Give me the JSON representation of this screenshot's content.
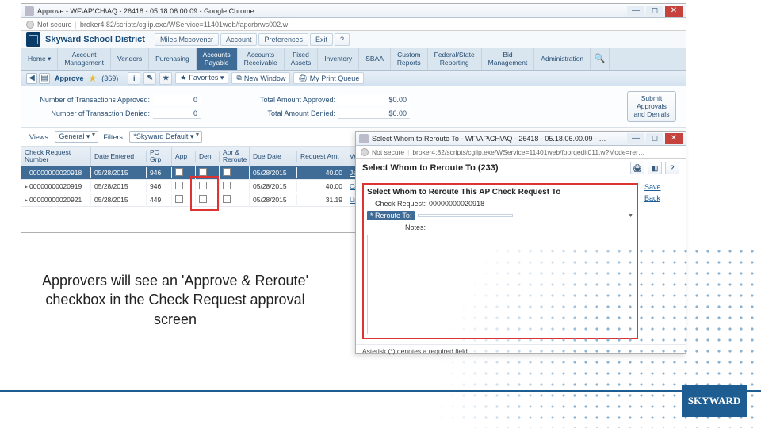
{
  "main": {
    "title": "Approve - WF\\AP\\CH\\AQ - 26418 - 05.18.06.00.09 - Google Chrome",
    "security_label": "Not secure",
    "url": "broker4:82/scripts/cgiip.exe/WService=11401web/fapcrbrws002.w",
    "brand": "Skyward School District",
    "top_links": [
      "Miles Mccovencr",
      "Account",
      "Preferences",
      "Exit",
      "?"
    ],
    "nav_tabs": [
      "Home ▾",
      "Account\nManagement",
      "Vendors",
      "Purchasing",
      "Accounts\nPayable",
      "Accounts\nReceivable",
      "Fixed\nAssets",
      "Inventory",
      "SBAA",
      "Custom\nReports",
      "Federal/State\nReporting",
      "Bid\nManagement",
      "Administration"
    ],
    "section": {
      "title": "Approve",
      "count": "(369)"
    },
    "toolbar": {
      "favorites": "Favorites ▾",
      "new_window": "New Window",
      "print_queue": "My Print Queue"
    },
    "stats": {
      "trans_approved_label": "Number of Transactions Approved:",
      "trans_approved": "0",
      "trans_denied_label": "Number of Transaction Denied:",
      "trans_denied": "0",
      "amt_approved_label": "Total Amount Approved:",
      "amt_approved": "$0.00",
      "amt_denied_label": "Total Amount Denied:",
      "amt_denied": "$0.00",
      "submit": "Submit\nApprovals\nand\nDenials"
    },
    "views_label": "Views:",
    "views_value": "General ▾",
    "filters_label": "Filters:",
    "filters_value": "*Skyward Default ▾",
    "grid_headers": [
      "Check Request\nNumber",
      "Date Entered",
      "PO\nGrp",
      "App",
      "Den",
      "Apr &\nReroute",
      "Due Date",
      "Request Amt",
      "Vendor Name"
    ],
    "rows": [
      {
        "num": "00000000020918",
        "date": "05/28/2015",
        "grp": "946",
        "due": "05/28/2015",
        "amt": "40.00",
        "vendor": "Jedrysescy Evan P"
      },
      {
        "num": "00000000020919",
        "date": "05/28/2015",
        "grp": "946",
        "due": "05/28/2015",
        "amt": "40.00",
        "vendor": "Calfersor Salome R"
      },
      {
        "num": "00000000020921",
        "date": "05/28/2015",
        "grp": "449",
        "due": "05/28/2015",
        "amt": "31.19",
        "vendor": "Urservycr Grace X"
      }
    ]
  },
  "callout": "Approvers will see an 'Approve & Reroute' checkbox in the Check Request approval screen",
  "popup": {
    "title": "Select Whom to Reroute To - WF\\AP\\CH\\AQ - 26418 - 05.18.06.00.09 - …",
    "security_label": "Not secure",
    "url": "broker4:82/scripts/cgiip.exe/WService=11401web/fporqedit011.w?Mode=rer…",
    "heading": "Select Whom to Reroute To (233)",
    "panel_title": "Select Whom to Reroute This AP Check Request To",
    "check_request_label": "Check Request:",
    "check_request_value": "00000000020918",
    "reroute_label": "* Reroute To:",
    "notes_label": "Notes:",
    "save": "Save",
    "back": "Back",
    "req_note": "Asterisk (*) denotes a required field"
  },
  "footer_brand": "SKYWARD"
}
